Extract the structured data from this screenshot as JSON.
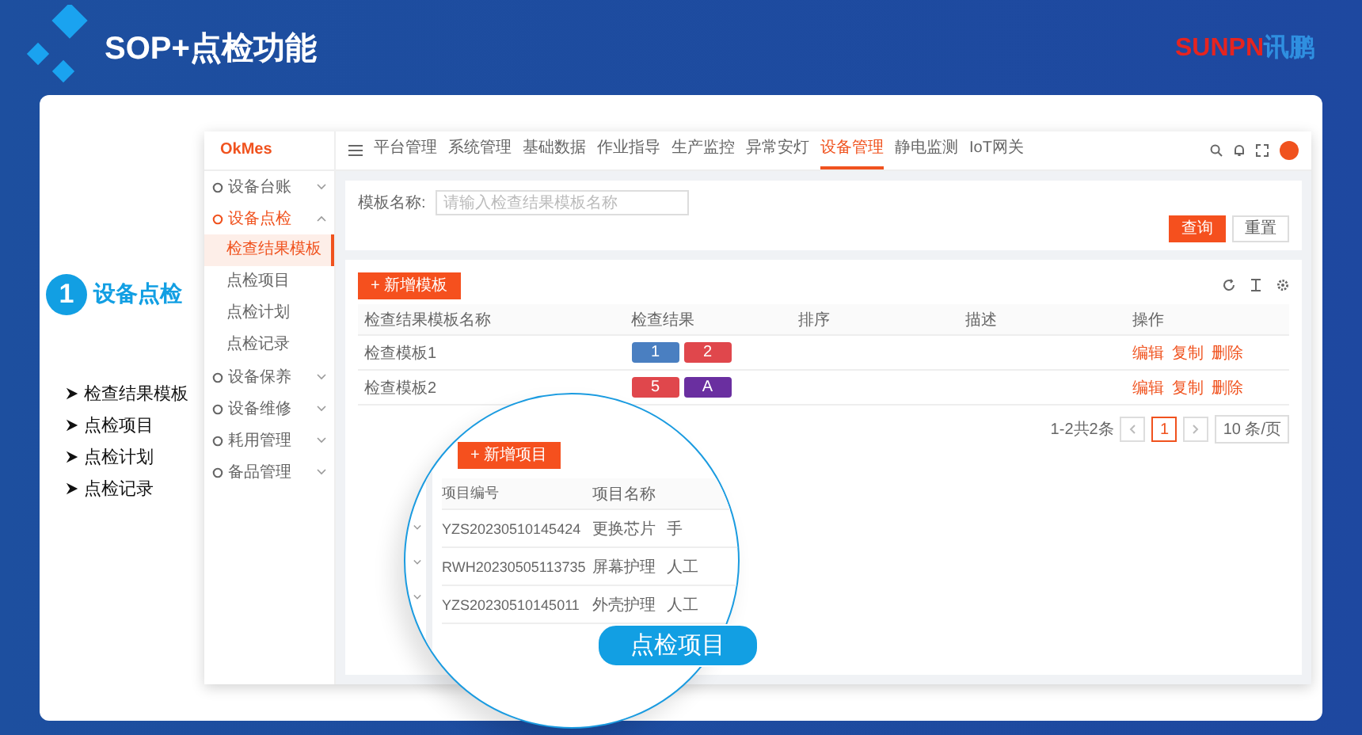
{
  "slide": {
    "title": "SOP+点检功能",
    "logo": {
      "latin": "SUNPN",
      "cjk": "讯鹏"
    }
  },
  "feature": {
    "number": "1",
    "title": "设备点检",
    "points": [
      "检查结果模板",
      "点检项目",
      "点检计划",
      "点检记录"
    ]
  },
  "app": {
    "brand": "OkMes",
    "nav": [
      {
        "label": "平台管理",
        "selected": false
      },
      {
        "label": "系统管理",
        "selected": false
      },
      {
        "label": "基础数据",
        "selected": false
      },
      {
        "label": "作业指导",
        "selected": false
      },
      {
        "label": "生产监控",
        "selected": false
      },
      {
        "label": "异常安灯",
        "selected": false
      },
      {
        "label": "设备管理",
        "selected": true
      },
      {
        "label": "静电监测",
        "selected": false
      },
      {
        "label": "IoT网关",
        "selected": false
      }
    ],
    "sidebar": [
      {
        "label": "设备台账",
        "expanded": false
      },
      {
        "label": "设备点检",
        "expanded": true,
        "children": [
          {
            "label": "检查结果模板",
            "selected": true
          },
          {
            "label": "点检项目",
            "selected": false
          },
          {
            "label": "点检计划",
            "selected": false
          },
          {
            "label": "点检记录",
            "selected": false
          }
        ]
      },
      {
        "label": "设备保养",
        "expanded": false
      },
      {
        "label": "设备维修",
        "expanded": false
      },
      {
        "label": "耗用管理",
        "expanded": false
      },
      {
        "label": "备品管理",
        "expanded": false
      }
    ],
    "filter": {
      "label": "模板名称:",
      "placeholder": "请输入检查结果模板名称",
      "buttons": [
        "查询",
        "重置"
      ]
    },
    "add_button": "+ 新增模板",
    "table": {
      "columns": [
        "检查结果模板名称",
        "检查结果",
        "排序",
        "描述",
        "操作"
      ],
      "rows": [
        {
          "name": "检查模板1",
          "results": [
            {
              "label": "1",
              "color": "#4a7fc1"
            },
            {
              "label": "2",
              "color": "#e0474c"
            }
          ],
          "actions": [
            "编辑",
            "复制",
            "删除"
          ]
        },
        {
          "name": "检查模板2",
          "results": [
            {
              "label": "5",
              "color": "#e0474c"
            },
            {
              "label": "A",
              "color": "#6a2fa0"
            }
          ],
          "actions": [
            "编辑",
            "复制",
            "删除"
          ]
        }
      ]
    },
    "pagination": {
      "summary": "1-2共2条",
      "pages": [
        {
          "label": "1",
          "selected": true
        }
      ],
      "page_size": "10 条/页"
    }
  },
  "magnifier": {
    "add_button": "+ 新增项目",
    "columns": [
      "项目编号",
      "项目名称"
    ],
    "rows": [
      [
        "YZS20230510145424",
        "更换芯片",
        "手"
      ],
      [
        "RWH20230505113735",
        "屏幕护理",
        "人工"
      ],
      [
        "YZS20230510145011",
        "外壳护理",
        "人工"
      ]
    ],
    "label": "点检项目"
  }
}
